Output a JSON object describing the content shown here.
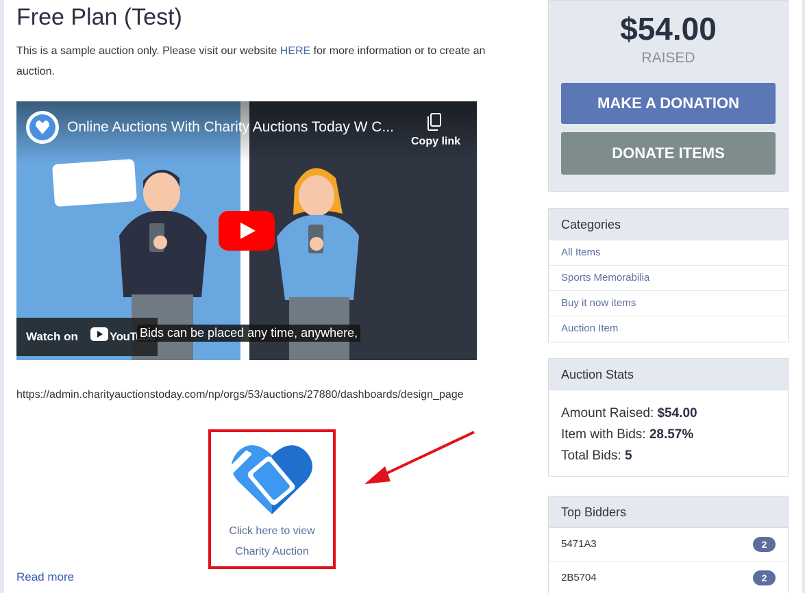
{
  "page": {
    "title": "Free Plan (Test)",
    "intro_before": "This is a sample auction only. Please visit our website ",
    "intro_link": "HERE",
    "intro_after": " for more information or to create an auction.",
    "url_text": "https://admin.charityauctionstoday.com/np/orgs/53/auctions/27880/dashboards/design_page",
    "read_more": "Read more"
  },
  "video": {
    "title": "Online Auctions With Charity Auctions Today W C...",
    "copy_label": "Copy link",
    "watch_label": "Watch on",
    "youtube_label": "YouTube",
    "caption": "Bids can be placed any time, anywhere,"
  },
  "auction_link": {
    "line1": "Click here to view",
    "line2": "Charity Auction"
  },
  "sidebar": {
    "raised_amount": "$54.00",
    "raised_label": "RAISED",
    "donate_button": "MAKE A DONATION",
    "items_button": "DONATE ITEMS",
    "categories": {
      "title": "Categories",
      "items": [
        "All Items",
        "Sports Memorabilia",
        "Buy it now items",
        "Auction Item"
      ]
    },
    "stats": {
      "title": "Auction Stats",
      "amount_label": "Amount Raised: ",
      "amount_value": "$54.00",
      "bids_label": "Item with Bids: ",
      "bids_value": "28.57%",
      "total_label": "Total Bids: ",
      "total_value": "5"
    },
    "bidders": {
      "title": "Top Bidders",
      "rows": [
        {
          "id": "5471A3",
          "count": "2"
        },
        {
          "id": "2B5704",
          "count": "2"
        }
      ]
    }
  },
  "colors": {
    "accent_blue": "#5b77b5",
    "donate_items_gray": "#7f8c8c",
    "highlight_red": "#e3111c",
    "link_blue": "#4a68b0"
  },
  "icons": [
    "channel-logo-icon",
    "copy-link-icon",
    "play-icon",
    "youtube-icon",
    "charity-heart-icon",
    "red-arrow-icon"
  ]
}
